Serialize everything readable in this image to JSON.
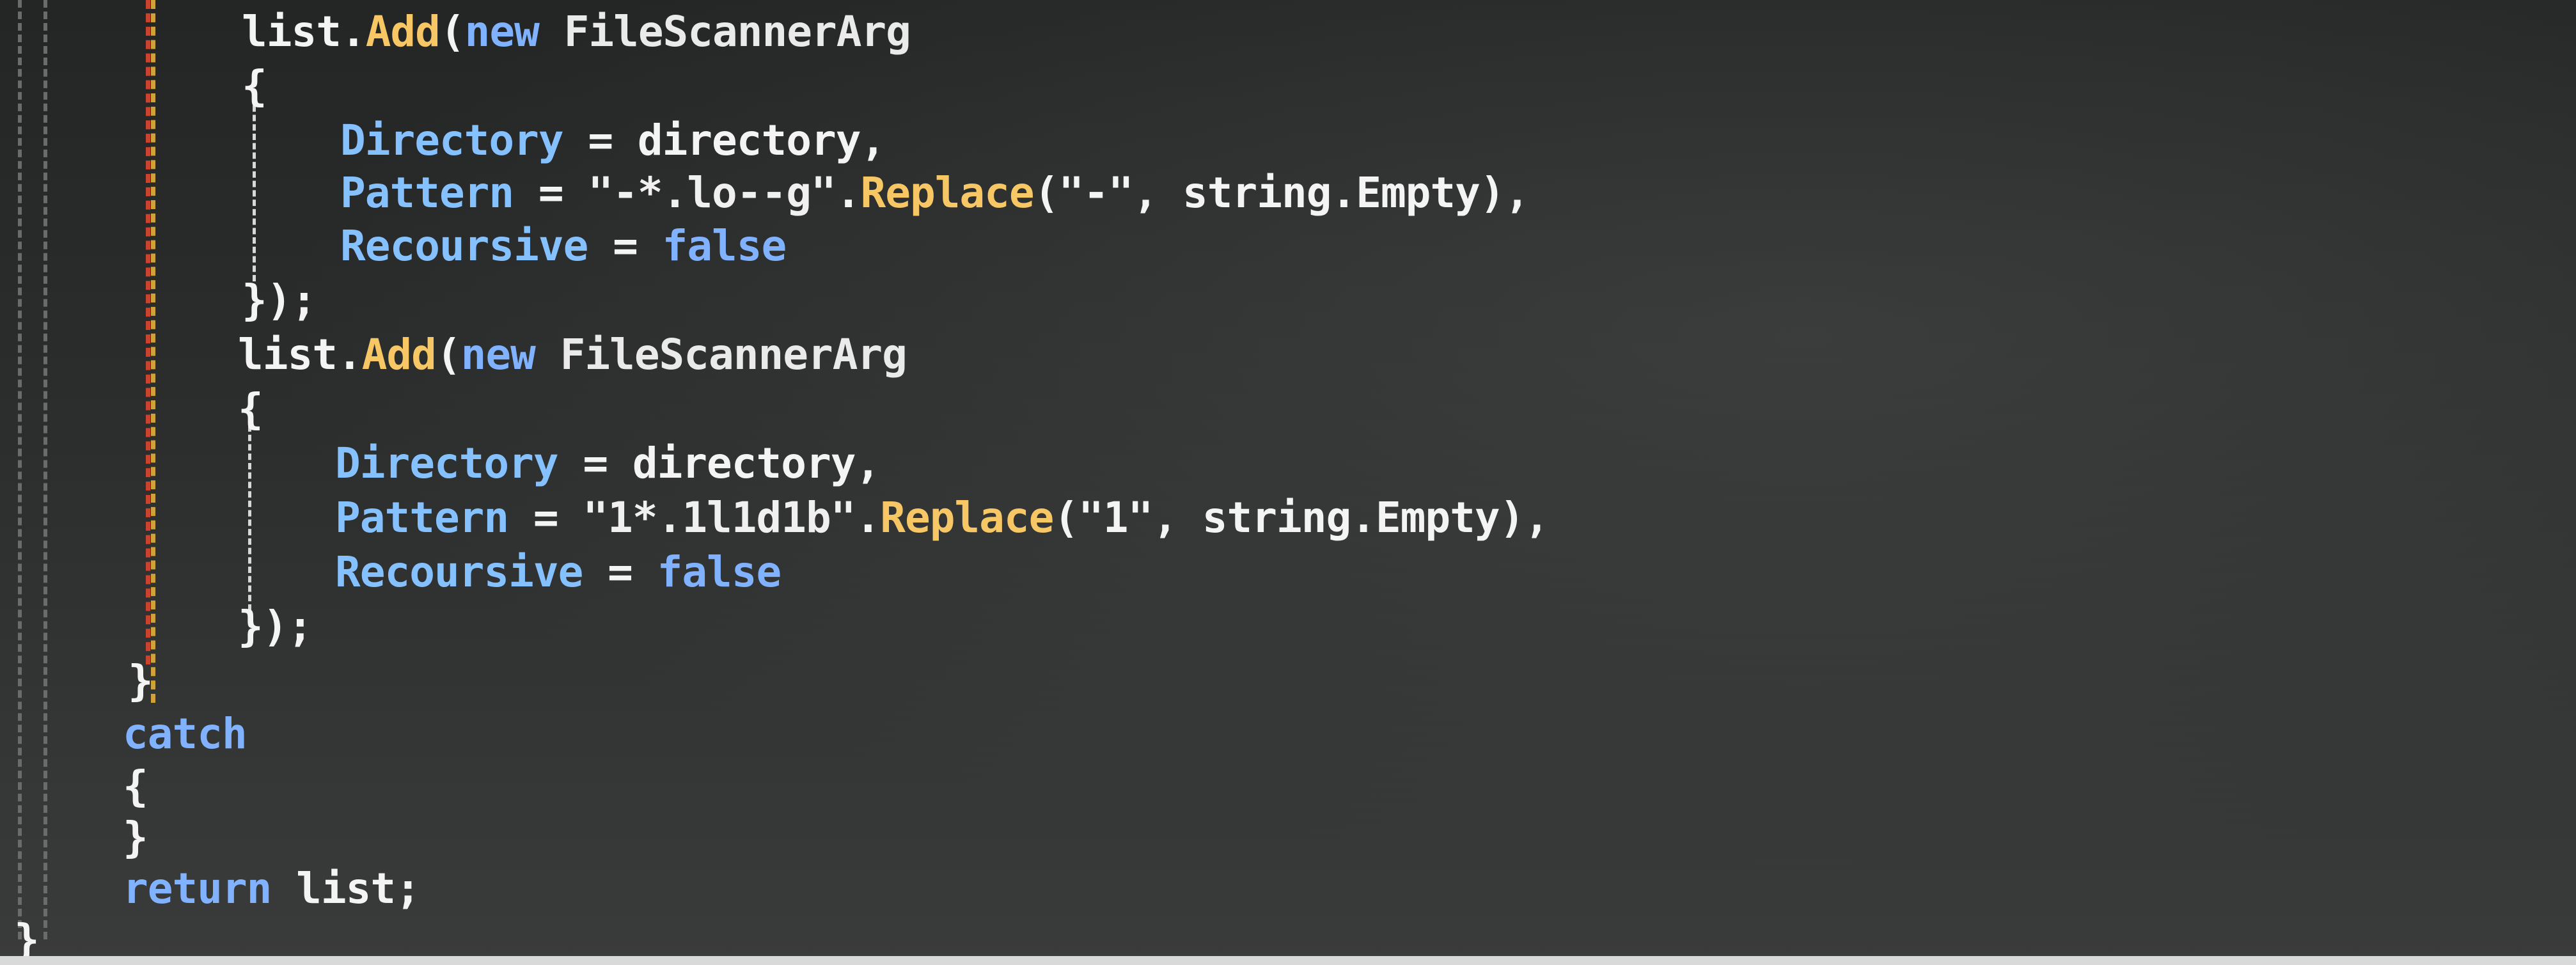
{
  "editor": {
    "language": "C#",
    "colors": {
      "background": "#2a2c2c",
      "keyword": "#80b2ff",
      "method": "#f7c766",
      "property": "#86c1ff",
      "text": "#f2f2f2",
      "margin_red": "#c9432f",
      "margin_gold": "#cfa23a"
    },
    "lines": [
      {
        "tokens": [
          {
            "t": "list.",
            "c": "plain"
          },
          {
            "t": "Add",
            "c": "method"
          },
          {
            "t": "(",
            "c": "punc"
          },
          {
            "t": "new",
            "c": "kw"
          },
          {
            "t": " FileScannerArg",
            "c": "type"
          }
        ]
      },
      {
        "tokens": [
          {
            "t": "{",
            "c": "punc"
          }
        ]
      },
      {
        "tokens": [
          {
            "t": "Directory",
            "c": "prop"
          },
          {
            "t": " = directory,",
            "c": "plain"
          }
        ]
      },
      {
        "tokens": [
          {
            "t": "Pattern",
            "c": "prop"
          },
          {
            "t": " = ",
            "c": "plain"
          },
          {
            "t": "\"-*.lo--g\"",
            "c": "str"
          },
          {
            "t": ".",
            "c": "plain"
          },
          {
            "t": "Replace",
            "c": "method"
          },
          {
            "t": "(\"-\", string.",
            "c": "plain"
          },
          {
            "t": "Empty",
            "c": "plain"
          },
          {
            "t": "),",
            "c": "plain"
          }
        ]
      },
      {
        "tokens": [
          {
            "t": "Recoursive",
            "c": "prop"
          },
          {
            "t": " = ",
            "c": "plain"
          },
          {
            "t": "false",
            "c": "kw"
          }
        ]
      },
      {
        "tokens": [
          {
            "t": "});",
            "c": "punc"
          }
        ]
      },
      {
        "tokens": [
          {
            "t": "list.",
            "c": "plain"
          },
          {
            "t": "Add",
            "c": "method"
          },
          {
            "t": "(",
            "c": "punc"
          },
          {
            "t": "new",
            "c": "kw"
          },
          {
            "t": " FileScannerArg",
            "c": "type"
          }
        ]
      },
      {
        "tokens": [
          {
            "t": "{",
            "c": "punc"
          }
        ]
      },
      {
        "tokens": [
          {
            "t": "Directory",
            "c": "prop"
          },
          {
            "t": " = directory,",
            "c": "plain"
          }
        ]
      },
      {
        "tokens": [
          {
            "t": "Pattern",
            "c": "prop"
          },
          {
            "t": " = ",
            "c": "plain"
          },
          {
            "t": "\"1*.1l1d1b\"",
            "c": "str"
          },
          {
            "t": ".",
            "c": "plain"
          },
          {
            "t": "Replace",
            "c": "method"
          },
          {
            "t": "(\"1\", string.",
            "c": "plain"
          },
          {
            "t": "Empty",
            "c": "plain"
          },
          {
            "t": "),",
            "c": "plain"
          }
        ]
      },
      {
        "tokens": [
          {
            "t": "Recoursive",
            "c": "prop"
          },
          {
            "t": " = ",
            "c": "plain"
          },
          {
            "t": "false",
            "c": "kw"
          }
        ]
      },
      {
        "tokens": [
          {
            "t": "});",
            "c": "punc"
          }
        ]
      },
      {
        "tokens": [
          {
            "t": "}",
            "c": "punc"
          }
        ]
      },
      {
        "tokens": [
          {
            "t": "catch",
            "c": "kw"
          }
        ]
      },
      {
        "tokens": [
          {
            "t": "{",
            "c": "punc"
          }
        ]
      },
      {
        "tokens": [
          {
            "t": "}",
            "c": "punc"
          }
        ]
      },
      {
        "tokens": [
          {
            "t": "return",
            "c": "kw"
          },
          {
            "t": " list;",
            "c": "plain"
          }
        ]
      },
      {
        "tokens": [
          {
            "t": "}",
            "c": "punc"
          }
        ]
      }
    ]
  }
}
